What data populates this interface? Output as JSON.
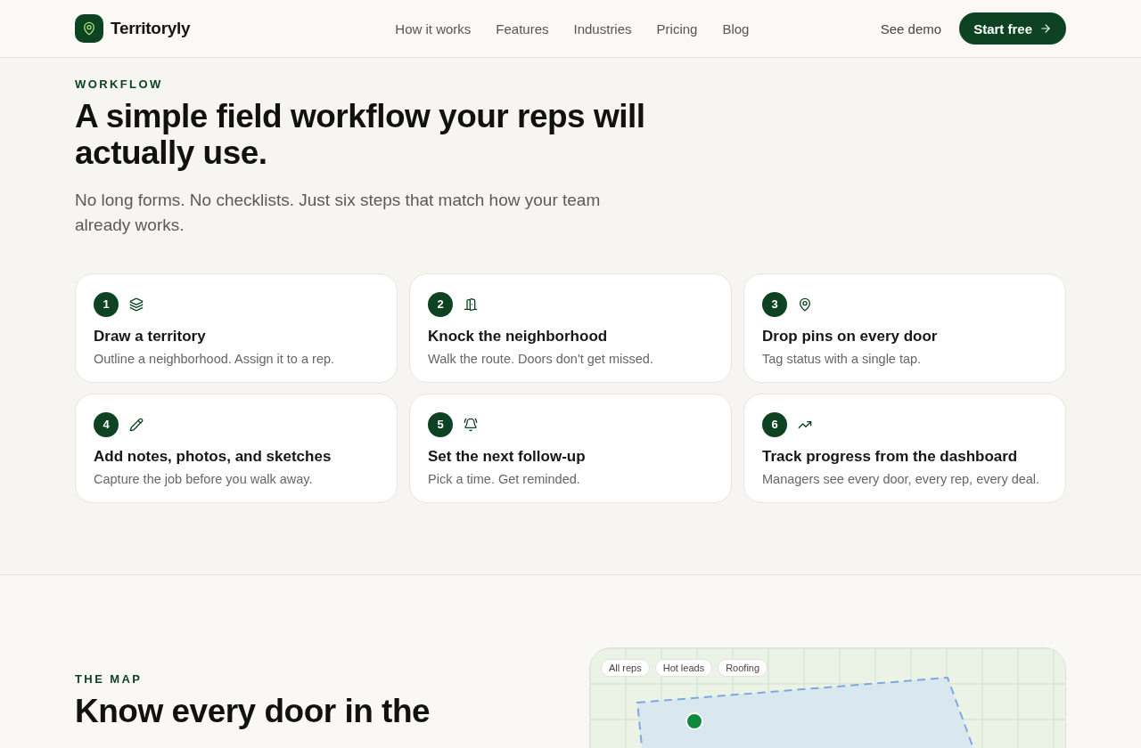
{
  "header": {
    "brand": "Territoryly",
    "nav": [
      "How it works",
      "Features",
      "Industries",
      "Pricing",
      "Blog"
    ],
    "secondary_action": "See demo",
    "primary_action": "Start free"
  },
  "workflow": {
    "eyebrow": "WORKFLOW",
    "title": "A simple field workflow your reps will actually use.",
    "subtitle": "No long forms. No checklists. Just six steps that match how your team already works.",
    "steps": [
      {
        "number": "1",
        "title": "Draw a territory",
        "text": "Outline a neighborhood. Assign it to a rep."
      },
      {
        "number": "2",
        "title": "Knock the neighborhood",
        "text": "Walk the route. Doors don't get missed."
      },
      {
        "number": "3",
        "title": "Drop pins on every door",
        "text": "Tag status with a single tap."
      },
      {
        "number": "4",
        "title": "Add notes, photos, and sketches",
        "text": "Capture the job before you walk away."
      },
      {
        "number": "5",
        "title": "Set the next follow-up",
        "text": "Pick a time. Get reminded."
      },
      {
        "number": "6",
        "title": "Track progress from the dashboard",
        "text": "Managers see every door, every rep, every deal."
      }
    ]
  },
  "map_section": {
    "eyebrow": "THE MAP",
    "title": "Know every door in the",
    "filters": [
      "All reps",
      "Hot leads",
      "Roofing"
    ]
  }
}
